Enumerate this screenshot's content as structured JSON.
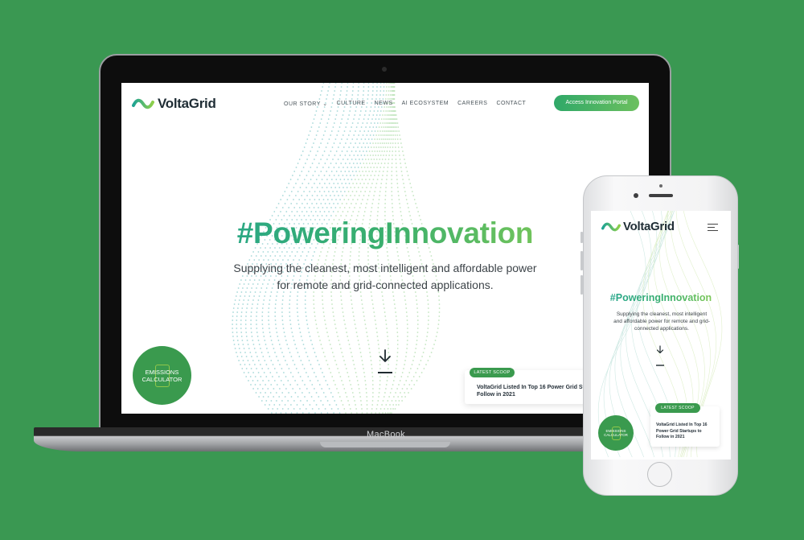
{
  "brand": {
    "name": "VoltaGrid",
    "accent": "#3a9a4e",
    "gradient_start": "#1fa394",
    "gradient_end": "#9ad34d"
  },
  "desktop": {
    "nav": [
      "OUR STORY",
      "CULTURE",
      "NEWS",
      "AI ECOSYSTEM",
      "CAREERS",
      "CONTACT"
    ],
    "cta_label": "Access Innovation Portal",
    "hero_title": "#PoweringInnovation",
    "hero_sub_line1": "Supplying the cleanest, most intelligent and affordable power",
    "hero_sub_line2": "for remote and grid-connected applications.",
    "emissions_line1": "EMISSIONS",
    "emissions_line2": "CALCULATOR",
    "scoop_badge": "LATEST SCOOP",
    "scoop_line1": "VoltaGrid Listed In Top 16 Power Grid St",
    "scoop_line2": "Follow in 2021"
  },
  "laptop_label": "MacBook",
  "mobile": {
    "hero_title": "#PoweringInnovation",
    "hero_sub_line1": "Supplying the cleanest, most intelligent",
    "hero_sub_line2": "and affordable power for remote and grid-",
    "hero_sub_line3": "connected applications.",
    "emissions_line1": "EMISSIONS",
    "emissions_line2": "CALCULATOR",
    "scoop_badge": "LATEST SCOOP",
    "scoop_line1": "VoltaGrid Listed In Top 16",
    "scoop_line2": "Power Grid Startups to",
    "scoop_line3": "Follow in 2021"
  },
  "icons": [
    "logo-wave-icon",
    "chevron-down-icon",
    "arrow-down-icon",
    "calculator-icon",
    "hamburger-menu-icon"
  ]
}
